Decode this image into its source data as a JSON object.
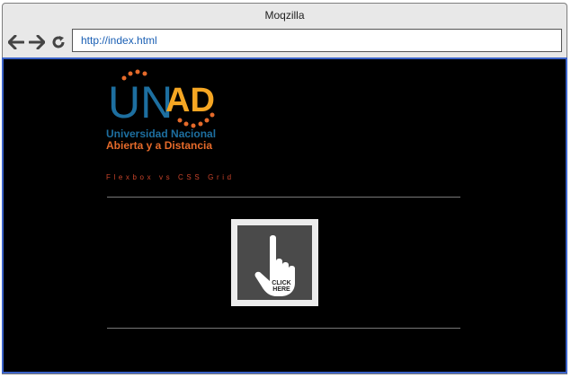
{
  "window": {
    "title": "Moqzilla"
  },
  "toolbar": {
    "back_icon": "arrow-left-icon",
    "forward_icon": "arrow-right-icon",
    "reload_icon": "reload-icon",
    "url": "http://index.html"
  },
  "page": {
    "logo": {
      "brand_left": "UN",
      "brand_right": "AD",
      "line1": "Universidad Nacional",
      "line2": "Abierta y a Distancia"
    },
    "subtitle": "Flexbox vs CSS Grid",
    "click_image": {
      "icon": "pointing-hand-icon",
      "label_line1": "CLICK",
      "label_line2": "HERE"
    }
  },
  "colors": {
    "page_background": "#000000",
    "viewport_border": "#3b63c9",
    "url_text": "#1a5fb4",
    "logo_blue": "#1d6fa0",
    "logo_orange": "#e56a2a",
    "subtitle": "#c8432a"
  }
}
